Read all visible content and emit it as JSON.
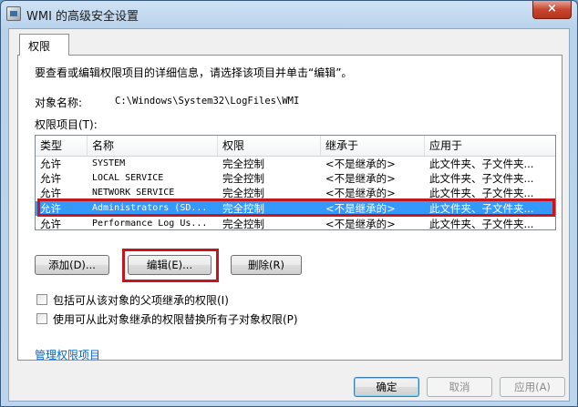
{
  "window": {
    "title": "WMI 的高级安全设置",
    "close_label": "×"
  },
  "tabs": [
    {
      "label": "权限"
    }
  ],
  "panel": {
    "instruction": "要查看或编辑权限项目的详细信息，请选择该项目并单击“编辑”。",
    "object_name_label": "对象名称:",
    "object_name_value": "C:\\Windows\\System32\\LogFiles\\WMI",
    "entries_label": "权限项目(T):"
  },
  "table": {
    "columns": [
      "类型",
      "名称",
      "权限",
      "继承于",
      "应用于"
    ],
    "rows": [
      {
        "type": "允许",
        "name": "SYSTEM",
        "permission": "完全控制",
        "inherited": "<不是继承的>",
        "applies": "此文件夹、子文件夹..."
      },
      {
        "type": "允许",
        "name": "LOCAL SERVICE",
        "permission": "完全控制",
        "inherited": "<不是继承的>",
        "applies": "此文件夹、子文件夹..."
      },
      {
        "type": "允许",
        "name": "NETWORK SERVICE",
        "permission": "完全控制",
        "inherited": "<不是继承的>",
        "applies": "此文件夹、子文件夹..."
      },
      {
        "type": "允许",
        "name": "Administrators (SD...",
        "permission": "完全控制",
        "inherited": "<不是继承的>",
        "applies": "此文件夹、子文件夹..."
      },
      {
        "type": "允许",
        "name": "Performance Log Us...",
        "permission": "完全控制",
        "inherited": "<不是继承的>",
        "applies": "此文件夹、子文件夹..."
      }
    ],
    "selected_row": 3
  },
  "buttons": {
    "add": "添加(D)...",
    "edit": "编辑(E)...",
    "remove": "删除(R)"
  },
  "checkboxes": [
    {
      "label": "包括可从该对象的父项继承的权限(I)",
      "checked": false
    },
    {
      "label": "使用可从此对象继承的权限替换所有子对象权限(P)",
      "checked": false
    }
  ],
  "link": {
    "label": "管理权限项目"
  },
  "footer": {
    "ok": "确定",
    "cancel": "取消",
    "apply": "应用(A)"
  },
  "colors": {
    "selection": "#3399ff",
    "highlight_box": "#c4161c",
    "link": "#0066cc"
  }
}
